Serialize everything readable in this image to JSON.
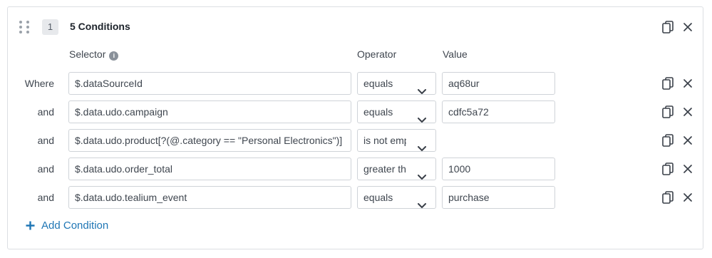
{
  "group": {
    "number": "1",
    "title": "5 Conditions"
  },
  "columns": {
    "selector": "Selector",
    "operator": "Operator",
    "value": "Value"
  },
  "info_glyph": "i",
  "rows": [
    {
      "label": "Where",
      "selector": "$.dataSourceId",
      "operator": "equals",
      "value": "aq68ur"
    },
    {
      "label": "and",
      "selector": "$.data.udo.campaign",
      "operator": "equals",
      "value": "cdfc5a72"
    },
    {
      "label": "and",
      "selector": "$.data.udo.product[?(@.category == \"Personal Electronics\")]",
      "operator": "is not emp",
      "value": null
    },
    {
      "label": "and",
      "selector": "$.data.udo.order_total",
      "operator": "greater th",
      "value": "1000"
    },
    {
      "label": "and",
      "selector": "$.data.udo.tealium_event",
      "operator": "equals",
      "value": "purchase"
    }
  ],
  "add_condition_label": "Add Condition",
  "icons": {
    "drag": "drag-handle-icon",
    "copy": "copy-icon",
    "close": "close-icon",
    "chevron": "chevron-down-icon",
    "info": "info-icon",
    "plus": "plus-icon"
  },
  "colors": {
    "accent": "#1f76b5",
    "border": "#cfd3d8",
    "card_border": "#dcdfe3",
    "badge_bg": "#e7e9ec"
  }
}
